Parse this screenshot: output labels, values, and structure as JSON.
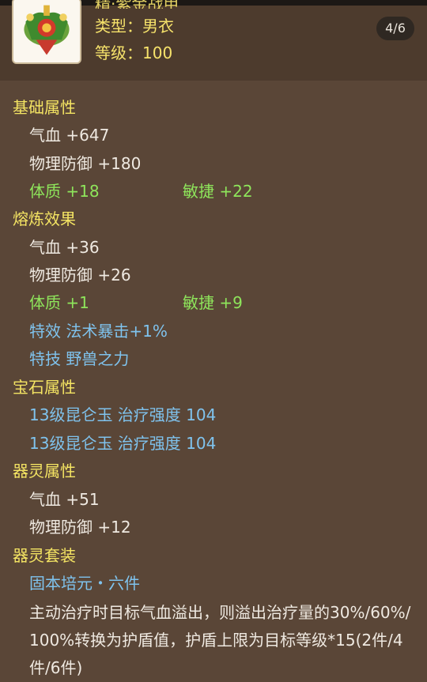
{
  "header": {
    "title_partial": "精·紫金战甲",
    "type_label": "类型：",
    "type_value": "男衣",
    "level_label": "等级：",
    "level_value": "100",
    "page_indicator": "4/6"
  },
  "basic": {
    "title": "基础属性",
    "hp": "气血 +647",
    "pdef": "物理防御 +180",
    "con": "体质 +18",
    "agi": "敏捷 +22"
  },
  "refine": {
    "title": "熔炼效果",
    "hp": "气血 +36",
    "pdef": "物理防御 +26",
    "con": "体质 +1",
    "agi": "敏捷 +9",
    "special_effect": "特效 法术暴击+1%",
    "special_skill": "特技 野兽之力"
  },
  "gem": {
    "title": "宝石属性",
    "line1": "13级昆仑玉 治疗强度 104",
    "line2": "13级昆仑玉 治疗强度 104"
  },
  "spirit": {
    "title": "器灵属性",
    "hp": "气血 +51",
    "pdef": "物理防御 +12"
  },
  "set": {
    "title": "器灵套装",
    "name": "固本培元・六件",
    "description": "主动治疗时目标气血溢出，则溢出治疗量的30%/60%/100%转换为护盾值，护盾上限为目标等级*15(2件/4件/6件)"
  },
  "colors": {
    "background": "#5a4637",
    "header_bg": "#4d3b2d",
    "section_yellow": "#f4e463",
    "attr_white": "#efe9e1",
    "attr_green": "#8ee55b",
    "attr_blue": "#7fc3ee"
  },
  "icons": {
    "item": "armor-item-icon"
  }
}
